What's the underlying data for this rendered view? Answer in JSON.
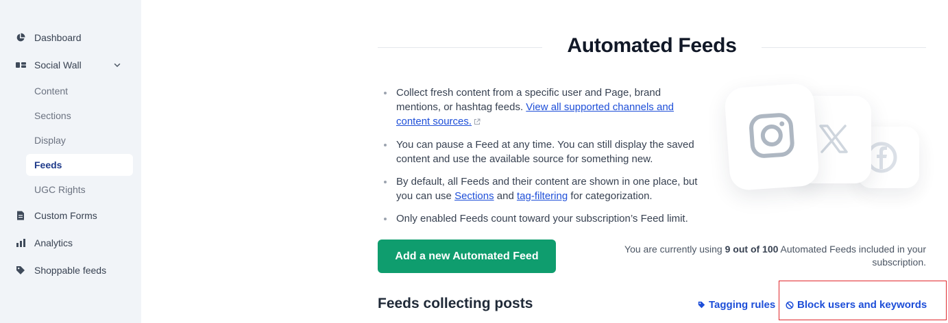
{
  "sidebar": {
    "items": [
      {
        "label": "Dashboard",
        "icon": "pie-chart-icon"
      },
      {
        "label": "Social Wall",
        "icon": "layout-icon"
      },
      {
        "label": "Custom Forms",
        "icon": "document-icon"
      },
      {
        "label": "Analytics",
        "icon": "bar-chart-icon"
      },
      {
        "label": "Shoppable feeds",
        "icon": "tag-icon"
      }
    ],
    "sub_items": [
      {
        "label": "Content"
      },
      {
        "label": "Sections"
      },
      {
        "label": "Display"
      },
      {
        "label": "Feeds",
        "active": true
      },
      {
        "label": "UGC Rights"
      }
    ]
  },
  "main": {
    "title": "Automated Feeds",
    "bullets": {
      "b1_text": "Collect fresh content from a specific user and Page, brand mentions, or hashtag feeds.",
      "b1_link": "View all supported channels and content sources.",
      "b2_text": "You can pause a Feed at any time. You can still display the saved content and use the available source for something new.",
      "b3_pre": "By default, all Feeds and their content are shown in one place, but you can use",
      "b3_link1": "Sections",
      "b3_mid": "and",
      "b3_link2": "tag-filtering",
      "b3_post": "for categorization.",
      "b4_text": "Only enabled Feeds count toward your subscription’s Feed limit."
    },
    "add_button": "Add a new Automated Feed",
    "usage": {
      "pre": "You are currently using",
      "count": "9 out of 100",
      "post": "Automated Feeds included in your subscription."
    },
    "section_heading": "Feeds collecting posts",
    "tagging_link": "Tagging rules",
    "block_link": "Block users and keywords"
  },
  "illustration": {
    "icons": [
      "instagram-icon",
      "x-icon",
      "facebook-icon"
    ]
  },
  "colors": {
    "primary_button": "#0f9d6e",
    "link": "#1d4ed8",
    "sidebar_bg": "#f1f4f8",
    "highlight": "#e0262b"
  }
}
